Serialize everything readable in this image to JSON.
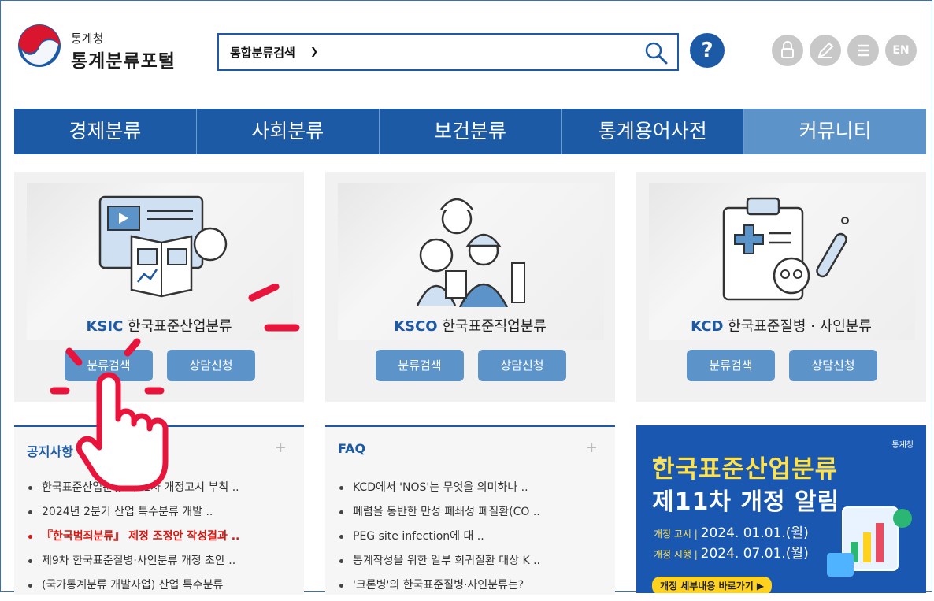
{
  "header": {
    "logo_sub": "통계청",
    "logo_main": "통계분류포털",
    "search_select": "통합분류검색",
    "help_label": "?",
    "en_label": "EN"
  },
  "nav": [
    "경제분류",
    "사회분류",
    "보건분류",
    "통계용어사전",
    "커뮤니티"
  ],
  "cards": [
    {
      "code": "KSIC",
      "name": " 한국표준산업분류",
      "btn1": "분류검색",
      "btn2": "상담신청"
    },
    {
      "code": "KSCO",
      "name": " 한국표준직업분류",
      "btn1": "분류검색",
      "btn2": "상담신청"
    },
    {
      "code": "KCD",
      "name": " 한국표준질병 · 사인분류",
      "btn1": "분류검색",
      "btn2": "상담신청"
    }
  ],
  "notice": {
    "title": "공지사항",
    "plus": "+",
    "items": [
      "한국표준산업분류 제11차 개정고시 부칙 ..",
      "2024년 2분기 산업 특수분류 개발 ..",
      "『한국범죄분류』 제정 조정안 작성결과 ..",
      "제9차 한국표준질병·사인분류 개정 초안 ..",
      "(국가통계분류 개발사업) 산업 특수분류"
    ]
  },
  "faq": {
    "title": "FAQ",
    "plus": "+",
    "items": [
      "KCD에서 'NOS'는 무엇을 의미하나 ..",
      "폐렴을 동반한 만성 폐쇄성 폐질환(CO ..",
      "PEG site infection에 대 ..",
      "통계작성을 위한 일부 희귀질환 대상 K ..",
      "'크론병'의 한국표준질병·사인분류는?"
    ]
  },
  "banner": {
    "agency": "통계청",
    "line1": "한국표준산업분류",
    "line2": "제11차 개정 알림",
    "notice_label": "개정 고시 | ",
    "notice_date": "2024. 01.01.(월)",
    "effect_label": "개정 시행 | ",
    "effect_date": "2024. 07.01.(월)",
    "link": "개정 세부내용 바로가기 ▶"
  },
  "colors": {
    "primary": "#1d5aa6",
    "light": "#5c93c8",
    "accent_red": "#d9160f",
    "banner_yellow": "#ffe14a"
  }
}
